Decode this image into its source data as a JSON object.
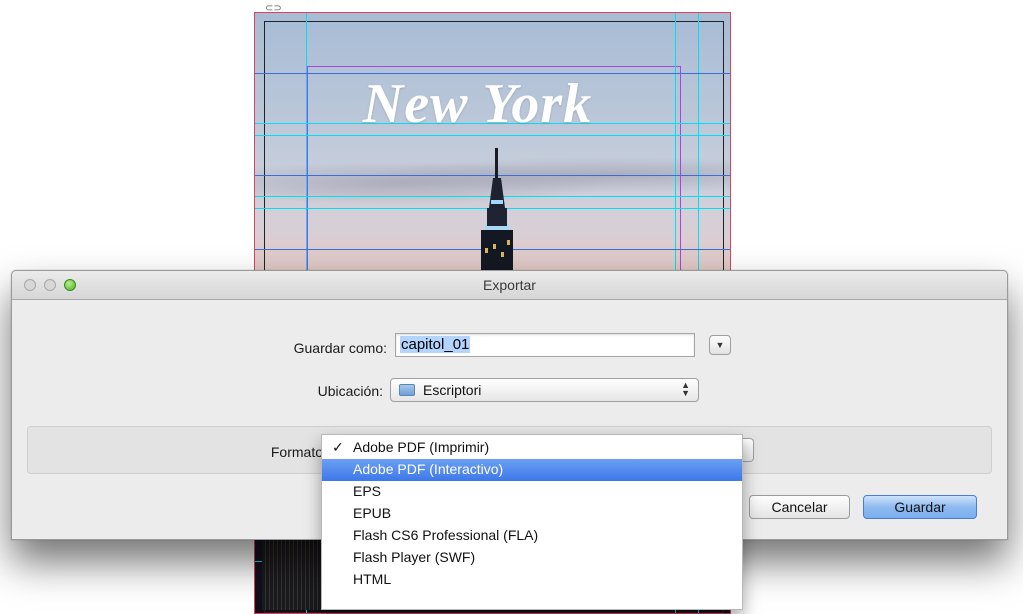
{
  "document": {
    "headline": "New York"
  },
  "dialog": {
    "title": "Exportar",
    "save_as_label": "Guardar como:",
    "save_as_value": "capitol_01",
    "location_label": "Ubicación:",
    "location_value": "Escriptori",
    "format_label": "Formato",
    "cancel_label": "Cancelar",
    "save_label": "Guardar"
  },
  "format_menu": {
    "selected": "Adobe PDF (Imprimir)",
    "check": "✓",
    "items": [
      "Adobe PDF (Imprimir)",
      "Adobe PDF (Interactivo)",
      "EPS",
      "EPUB",
      "Flash CS6 Professional (FLA)",
      "Flash Player (SWF)",
      "HTML"
    ],
    "highlighted_index": 1
  },
  "icons": {
    "close": "close-button-icon",
    "minimize": "minimize-button-icon",
    "zoom": "zoom-button-icon",
    "folder": "folder-icon",
    "link": "link-icon"
  }
}
